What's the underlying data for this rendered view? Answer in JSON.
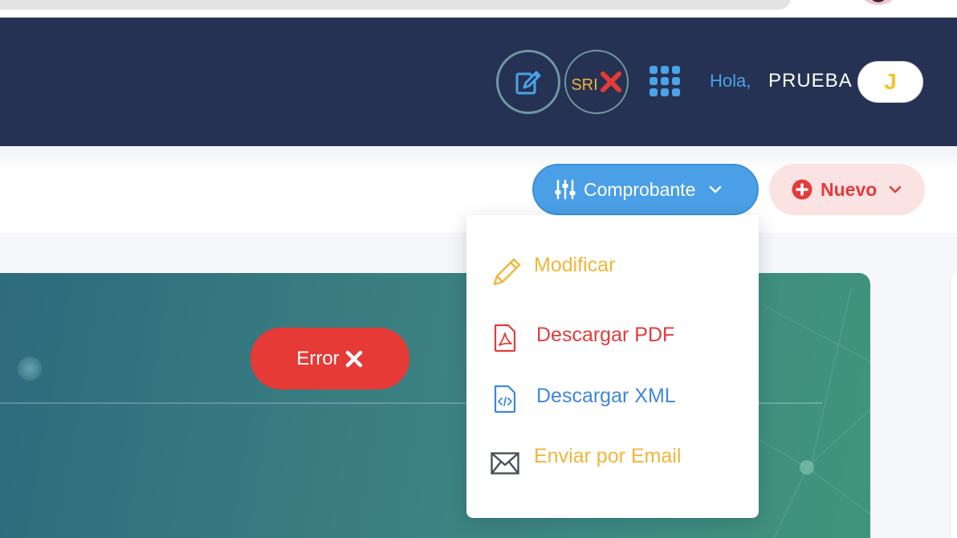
{
  "navbar": {
    "sri_label": "SRI",
    "greeting": "Hola,",
    "username": "PRUEBA",
    "avatar_initial": "J"
  },
  "toolbar": {
    "comprobante_label": "Comprobante",
    "nuevo_label": "Nuevo"
  },
  "dropdown": {
    "items": [
      {
        "label": "Modificar",
        "icon": "pencil-icon",
        "color": "#f2b53b"
      },
      {
        "label": "Descargar PDF",
        "icon": "pdf-file-icon",
        "color": "#e23b3b"
      },
      {
        "label": "Descargar XML",
        "icon": "xml-file-icon",
        "color": "#3f86e0"
      },
      {
        "label": "Enviar por Email",
        "icon": "envelope-icon",
        "color": "#f2b53b"
      }
    ]
  },
  "status": {
    "error_label": "Error"
  },
  "colors": {
    "navbar_bg": "#263253",
    "primary_blue": "#4a9fe6",
    "danger_red": "#e53a36",
    "accent_yellow": "#f2b53b"
  }
}
